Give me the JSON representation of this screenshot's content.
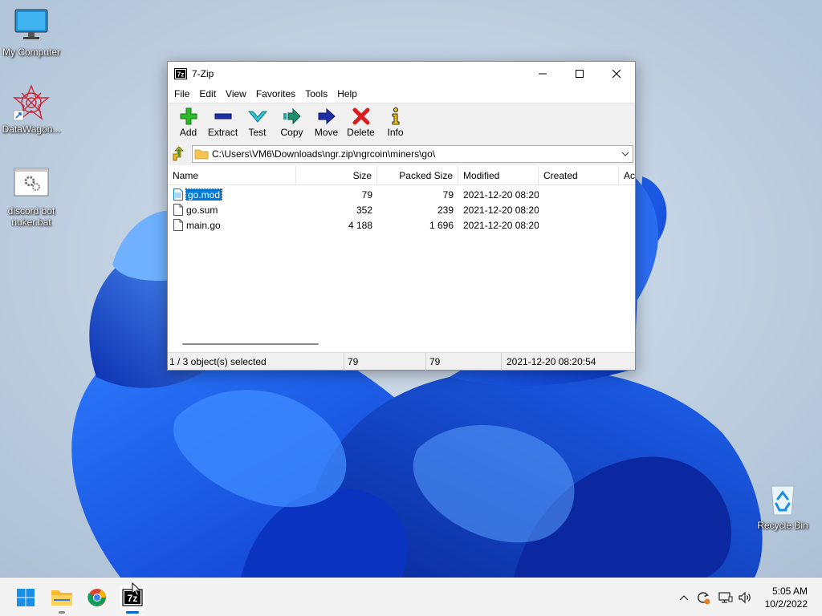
{
  "desktop": {
    "icons": [
      {
        "label": "My Computer",
        "icon": "monitor-icon"
      },
      {
        "label": "DataWagon...",
        "icon": "datawagon-app-icon"
      },
      {
        "label": "discord bot nuker.bat",
        "icon": "batch-file-icon"
      },
      {
        "label": "Recycle Bin",
        "icon": "recycle-bin-icon"
      }
    ]
  },
  "window": {
    "title": "7-Zip",
    "menu": [
      "File",
      "Edit",
      "View",
      "Favorites",
      "Tools",
      "Help"
    ],
    "toolbar": [
      {
        "label": "Add",
        "icon": "add-plus-icon"
      },
      {
        "label": "Extract",
        "icon": "extract-minus-icon"
      },
      {
        "label": "Test",
        "icon": "test-check-icon"
      },
      {
        "label": "Copy",
        "icon": "copy-arrow-icon"
      },
      {
        "label": "Move",
        "icon": "move-arrow-icon"
      },
      {
        "label": "Delete",
        "icon": "delete-x-icon"
      },
      {
        "label": "Info",
        "icon": "info-icon"
      }
    ],
    "address": "C:\\Users\\VM6\\Downloads\\ngr.zip\\ngrcoin\\miners\\go\\",
    "columns": [
      "Name",
      "Size",
      "Packed Size",
      "Modified",
      "Created",
      "Ac"
    ],
    "files": [
      {
        "name": "go.mod",
        "size": "79",
        "packed": "79",
        "modified": "2021-12-20 08:20",
        "selected": true
      },
      {
        "name": "go.sum",
        "size": "352",
        "packed": "239",
        "modified": "2021-12-20 08:20",
        "selected": false
      },
      {
        "name": "main.go",
        "size": "4 188",
        "packed": "1 696",
        "modified": "2021-12-20 08:20",
        "selected": false
      }
    ],
    "status": {
      "selection": "1 / 3 object(s) selected",
      "size": "79",
      "packed": "79",
      "modified": "2021-12-20 08:20:54"
    }
  },
  "taskbar": {
    "apps": [
      "start-windows-icon",
      "file-explorer-icon",
      "chrome-icon",
      "7zip-icon"
    ],
    "time": "5:05 AM",
    "date": "10/2/2022"
  },
  "colors": {
    "selection": "#0078d7",
    "taskbar_active": "#0067c0"
  }
}
